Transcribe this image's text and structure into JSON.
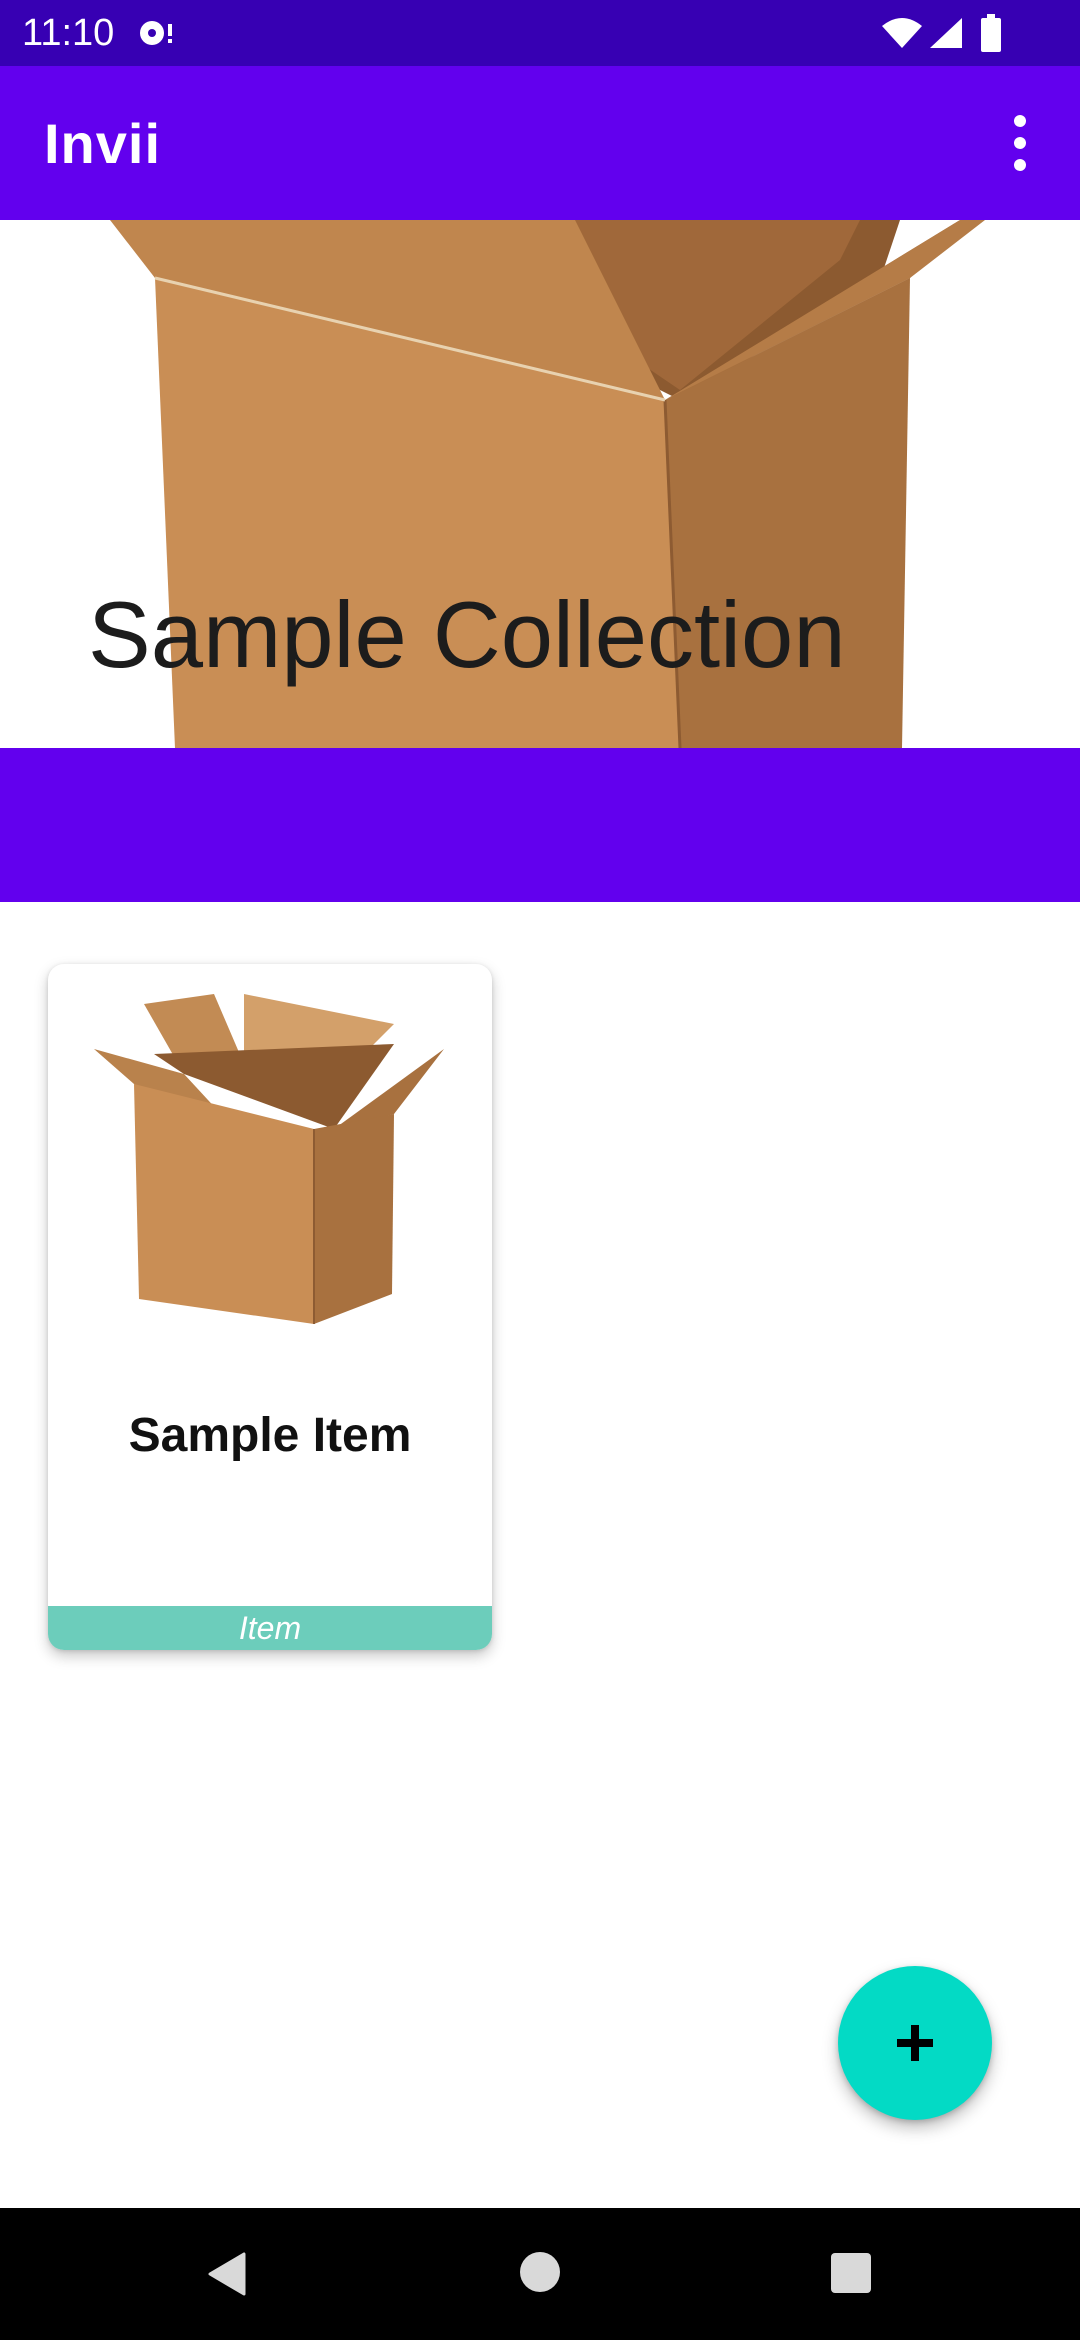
{
  "status_bar": {
    "time": "11:10",
    "icons": [
      "sync-icon",
      "wifi-icon",
      "signal-icon",
      "battery-icon"
    ]
  },
  "app_bar": {
    "title": "Invii",
    "menu_icon": "overflow-menu-icon"
  },
  "collection": {
    "title": "Sample Collection",
    "header_image": "cardboard-box-image"
  },
  "items": [
    {
      "name": "Sample Item",
      "type": "Item",
      "image": "cardboard-box-image"
    }
  ],
  "fab": {
    "icon": "plus-icon"
  },
  "nav_bar": {
    "icons": [
      "back-icon",
      "home-icon",
      "recents-icon"
    ]
  },
  "colors": {
    "status_bar": "#3700b3",
    "primary": "#6200ee",
    "accent": "#03dac5",
    "tag": "#6ccdbb",
    "box_front": "#c98e55",
    "box_side": "#a8713f",
    "box_inner": "#8c5a30"
  }
}
